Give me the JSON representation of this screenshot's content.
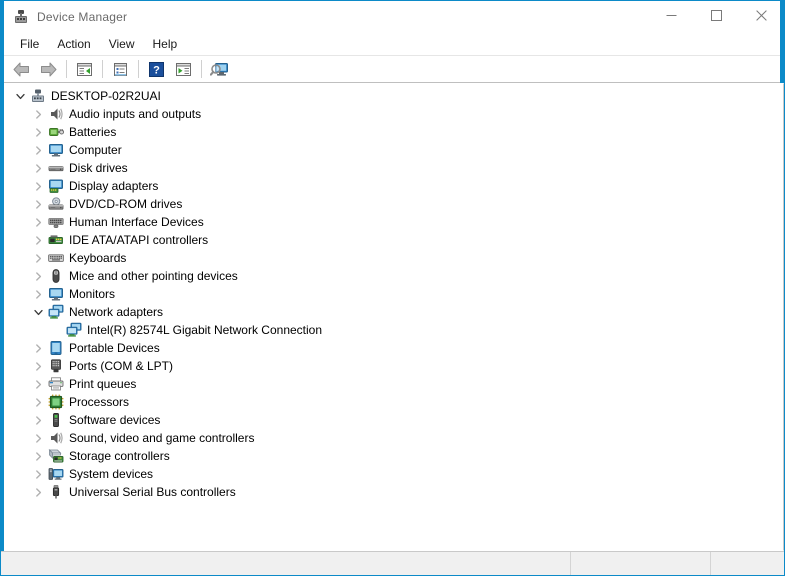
{
  "window": {
    "title": "Device Manager",
    "app_icon": "device-manager-icon",
    "accent_color": "#0c8ac8",
    "controls": [
      {
        "name": "minimize",
        "glyph": "minimize-icon"
      },
      {
        "name": "maximize",
        "glyph": "maximize-icon"
      },
      {
        "name": "close",
        "glyph": "close-icon"
      }
    ]
  },
  "menubar": {
    "items": [
      {
        "label": "File"
      },
      {
        "label": "Action"
      },
      {
        "label": "View"
      },
      {
        "label": "Help"
      }
    ]
  },
  "toolbar": {
    "buttons": [
      {
        "name": "back-button",
        "icon": "back-arrow-icon",
        "title": "Back"
      },
      {
        "name": "forward-button",
        "icon": "forward-arrow-icon",
        "title": "Forward"
      },
      {
        "name": "separator-1",
        "icon": "separator"
      },
      {
        "name": "show-hide-console-tree-button",
        "icon": "console-tree-icon",
        "title": "Show/Hide Console Tree"
      },
      {
        "name": "separator-2",
        "icon": "separator"
      },
      {
        "name": "properties-button",
        "icon": "properties-icon",
        "title": "Properties"
      },
      {
        "name": "separator-3",
        "icon": "separator"
      },
      {
        "name": "help-button",
        "icon": "help-question-icon",
        "title": "Help"
      },
      {
        "name": "update-driver-button",
        "icon": "update-driver-icon",
        "title": "Update Driver Software"
      },
      {
        "name": "separator-4",
        "icon": "separator"
      },
      {
        "name": "scan-hardware-changes-button",
        "icon": "scan-hardware-icon",
        "title": "Scan for hardware changes"
      }
    ]
  },
  "tree": {
    "nodes": [
      {
        "label": "DESKTOP-02R2UAI",
        "level": 0,
        "state": "expanded",
        "icon": "computer-root-icon"
      },
      {
        "label": "Audio inputs and outputs",
        "level": 1,
        "state": "collapsed",
        "icon": "speaker-icon"
      },
      {
        "label": "Batteries",
        "level": 1,
        "state": "collapsed",
        "icon": "battery-icon"
      },
      {
        "label": "Computer",
        "level": 1,
        "state": "collapsed",
        "icon": "monitor-icon"
      },
      {
        "label": "Disk drives",
        "level": 1,
        "state": "collapsed",
        "icon": "disk-drive-icon"
      },
      {
        "label": "Display adapters",
        "level": 1,
        "state": "collapsed",
        "icon": "display-adapter-icon"
      },
      {
        "label": "DVD/CD-ROM drives",
        "level": 1,
        "state": "collapsed",
        "icon": "dvd-drive-icon"
      },
      {
        "label": "Human Interface Devices",
        "level": 1,
        "state": "collapsed",
        "icon": "hid-icon"
      },
      {
        "label": "IDE ATA/ATAPI controllers",
        "level": 1,
        "state": "collapsed",
        "icon": "ide-controller-icon"
      },
      {
        "label": "Keyboards",
        "level": 1,
        "state": "collapsed",
        "icon": "keyboard-icon"
      },
      {
        "label": "Mice and other pointing devices",
        "level": 1,
        "state": "collapsed",
        "icon": "mouse-icon"
      },
      {
        "label": "Monitors",
        "level": 1,
        "state": "collapsed",
        "icon": "monitor-icon"
      },
      {
        "label": "Network adapters",
        "level": 1,
        "state": "expanded",
        "icon": "network-adapter-icon"
      },
      {
        "label": "Intel(R) 82574L Gigabit Network Connection",
        "level": 2,
        "state": "leaf",
        "icon": "network-adapter-icon"
      },
      {
        "label": "Portable Devices",
        "level": 1,
        "state": "collapsed",
        "icon": "portable-device-icon"
      },
      {
        "label": "Ports (COM & LPT)",
        "level": 1,
        "state": "collapsed",
        "icon": "port-icon"
      },
      {
        "label": "Print queues",
        "level": 1,
        "state": "collapsed",
        "icon": "printer-icon"
      },
      {
        "label": "Processors",
        "level": 1,
        "state": "collapsed",
        "icon": "processor-icon"
      },
      {
        "label": "Software devices",
        "level": 1,
        "state": "collapsed",
        "icon": "software-device-icon"
      },
      {
        "label": "Sound, video and game controllers",
        "level": 1,
        "state": "collapsed",
        "icon": "speaker-icon"
      },
      {
        "label": "Storage controllers",
        "level": 1,
        "state": "collapsed",
        "icon": "storage-controller-icon"
      },
      {
        "label": "System devices",
        "level": 1,
        "state": "collapsed",
        "icon": "system-device-icon"
      },
      {
        "label": "Universal Serial Bus controllers",
        "level": 1,
        "state": "collapsed",
        "icon": "usb-icon"
      }
    ]
  },
  "statusbar": {
    "pane1": "",
    "pane2": "",
    "pane3": ""
  }
}
